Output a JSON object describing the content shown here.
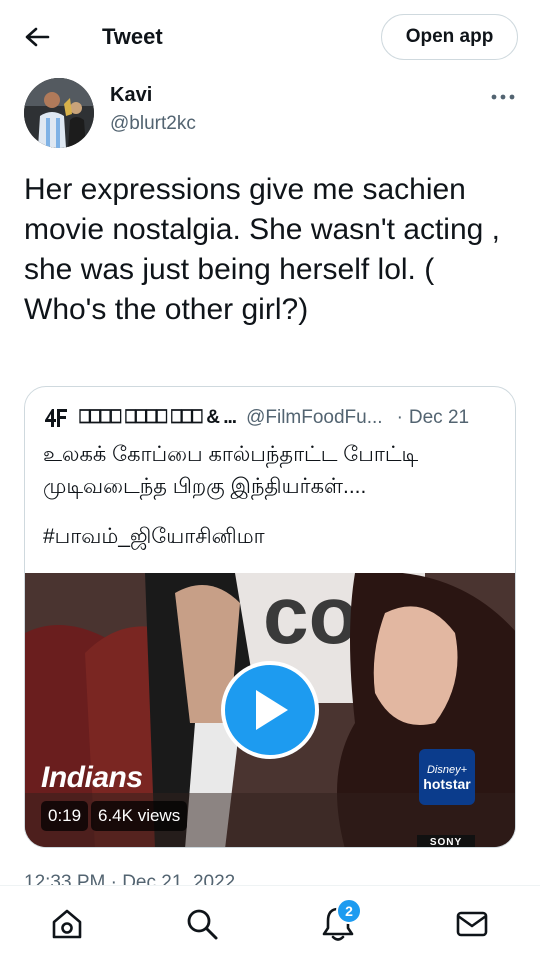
{
  "header": {
    "title": "Tweet",
    "open_app_label": "Open app",
    "back_icon": "arrow-left-icon"
  },
  "author": {
    "name": "Kavi",
    "handle": "@blurt2kc",
    "avatar_icon": "avatar",
    "more_icon": "more-horizontal-icon"
  },
  "tweet": {
    "text": "Her expressions give me sachien movie nostalgia. She wasn't acting , she was just being herself lol. ( Who's the other girl?)",
    "timestamp": "12:33 PM · Dec 21, 2022"
  },
  "quote": {
    "author_name": "⎕⎕⎕⎕ ⎕⎕⎕⎕ ⎕⎕⎕ & ...",
    "handle": "@FilmFoodFu...",
    "separator": "·",
    "date": "Dec 21",
    "text": "உலகக் கோப்பை கால்பந்தாட்ட போட்டி முடிவடைந்த பிறகு இந்தியர்கள்....",
    "hashtag": "#பாவம்_ஜியோசினிமா",
    "video": {
      "caption": "Indians",
      "duration": "0:19",
      "views": "6.4K views",
      "watermark_line1": "Disney+",
      "watermark_line2": "hotstar",
      "corner_logo": "SONY",
      "bg_text": "col"
    }
  },
  "nav": {
    "items": [
      "home-icon",
      "search-icon",
      "notifications-icon",
      "messages-icon"
    ],
    "notifications_badge": "2"
  },
  "colors": {
    "accent": "#1d9bf0",
    "text_primary": "#0f1419",
    "text_secondary": "#536471",
    "border": "#cfd9de"
  }
}
